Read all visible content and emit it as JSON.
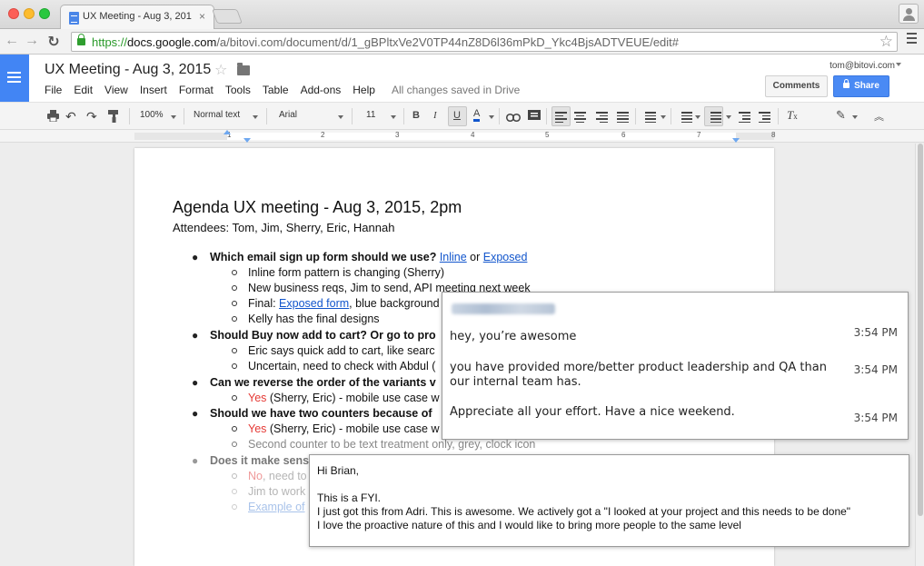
{
  "browser": {
    "tab_title": "UX Meeting - Aug 3, 2015",
    "tab_close": "×",
    "url_scheme": "https://",
    "url_host": "docs.google.com",
    "url_path": "/a/bitovi.com/document/d/1_gBPltxVe2V0TP44nZ8D6l36mPkD_Ykc4BjsADTVEUE/edit#"
  },
  "docs": {
    "title": "UX Meeting - Aug 3, 2015",
    "menu": [
      "File",
      "Edit",
      "View",
      "Insert",
      "Format",
      "Tools",
      "Table",
      "Add-ons",
      "Help"
    ],
    "save_status": "All changes saved in Drive",
    "user_email": "tom@bitovi.com",
    "comments_label": "Comments",
    "share_label": "Share"
  },
  "toolbar": {
    "zoom": "100%",
    "style": "Normal text",
    "font": "Arial",
    "size": "11",
    "bold": "B",
    "italic": "I",
    "underline": "U",
    "text_color": "A"
  },
  "ruler": {
    "numbers": [
      "1",
      "2",
      "3",
      "4",
      "5",
      "6",
      "7",
      "8"
    ]
  },
  "document": {
    "heading": "Agenda UX meeting - Aug 3, 2015, 2pm",
    "attendees": "Attendees: Tom, Jim, Sherry, Eric, Hannah",
    "q1": {
      "text": "Which email sign up form should we use? ",
      "link1": "Inline",
      "mid": " or ",
      "link2": "Exposed"
    },
    "q1_a": "Inline form pattern is changing (Sherry)",
    "q1_b": "New business reqs, Jim to send, API meeting next week",
    "q1_c": {
      "pre": "Final: ",
      "link": "Exposed form",
      "post": ", blue background"
    },
    "q1_d": "Kelly has the final designs",
    "q2": "Should Buy now add to cart? Or go to pro",
    "q2_a": "Eric says quick add to cart, like searc",
    "q2_b": "Uncertain, need to check with Abdul (",
    "q3": "Can we reverse the order of the variants v",
    "q3_a": {
      "yes": "Yes",
      "rest": " (Sherry, Eric) - mobile use case w"
    },
    "q4": "Should we have two counters because of",
    "q4_a": {
      "yes": "Yes",
      "rest": " (Sherry, Eric) - mobile use case w"
    },
    "q4_b": "Second counter to be text treatment only, grey, clock icon",
    "q5": "Does it make sens",
    "q5_a": {
      "no": "No",
      "rest": ", need to"
    },
    "q5_b": "Jim to work",
    "q5_c": "Example of"
  },
  "chat": {
    "messages": [
      {
        "text": "hey, you’re awesome",
        "time": "3:54 PM"
      },
      {
        "text": "you have provided more/better product leadership and QA than our internal team has.",
        "time": "3:54 PM"
      },
      {
        "text": "Appreciate all your effort. Have a nice weekend.",
        "time": "3:54 PM"
      }
    ]
  },
  "email": {
    "greeting": "Hi Brian,",
    "line1": "This is a FYI.",
    "line2": "I just got this from Adri. This is awesome. We actively got a \"I looked at your project and this needs to be done\"",
    "line3": "I love the proactive nature of this and I would like to bring more people to the same level"
  }
}
